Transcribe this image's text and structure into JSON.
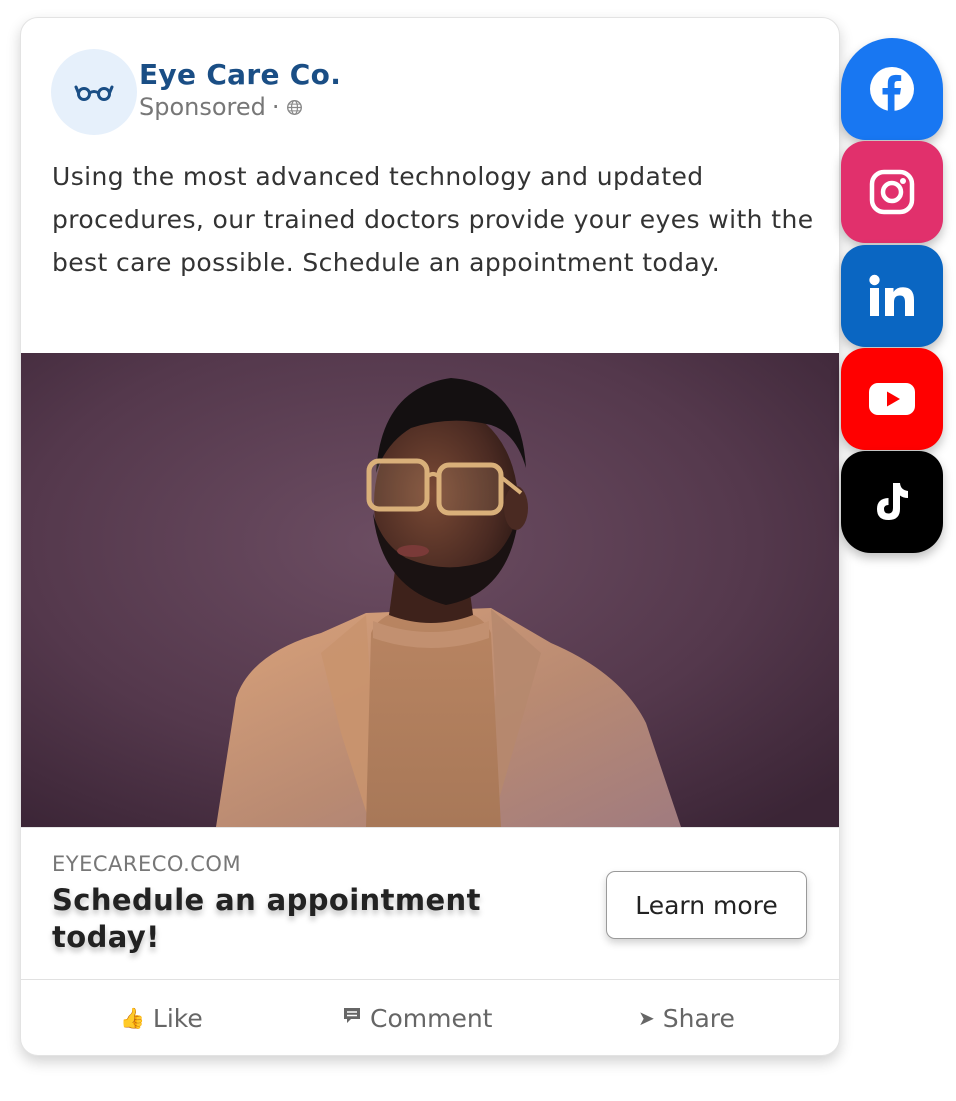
{
  "post": {
    "page_name": "Eye Care Co.",
    "sponsored": "Sponsored",
    "separator": "·",
    "body": "Using the most advanced technology and updated procedures, our trained doctors provide your eyes with the best care possible. Schedule an appointment today.",
    "avatar_icon": "glasses-icon",
    "audience_icon": "globe-icon"
  },
  "cta": {
    "domain": "EYECARECO.COM",
    "headline": "Schedule an appointment today!",
    "button_label": "Learn more"
  },
  "actions": {
    "like": "Like",
    "comment": "Comment",
    "share": "Share"
  },
  "social": [
    {
      "name": "Facebook",
      "icon": "facebook-icon",
      "color": "#1877f2"
    },
    {
      "name": "Instagram",
      "icon": "instagram-icon",
      "color": "#e1306c"
    },
    {
      "name": "LinkedIn",
      "icon": "linkedin-icon",
      "color": "#0a66c2"
    },
    {
      "name": "YouTube",
      "icon": "youtube-icon",
      "color": "#ff0000"
    },
    {
      "name": "TikTok",
      "icon": "tiktok-icon",
      "color": "#000000"
    }
  ],
  "colors": {
    "brand": "#1a4e85",
    "avatar_bg": "#e6f0fb"
  }
}
